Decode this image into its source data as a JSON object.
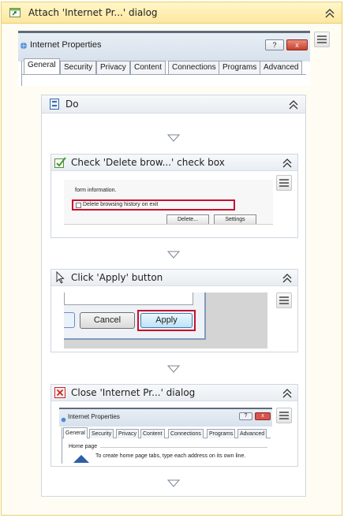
{
  "outer": {
    "title": "Attach 'Internet Pr...' dialog"
  },
  "window_preview": {
    "title": "Internet Properties",
    "help_button": "?",
    "close_button": "x",
    "tabs": [
      "General",
      "Security",
      "Privacy",
      "Content",
      "Connections",
      "Programs",
      "Advanced"
    ]
  },
  "sequence": {
    "title": "Do"
  },
  "check_activity": {
    "title": "Check 'Delete brow...' check box",
    "preview": {
      "text_line": "form information.",
      "checkbox_label": "Delete browsing history on exit",
      "delete_button": "Delete...",
      "settings_button": "Settings"
    }
  },
  "click_activity": {
    "title": "Click 'Apply' button",
    "preview": {
      "cancel_button": "Cancel",
      "apply_button": "Apply"
    }
  },
  "close_activity": {
    "title": "Close 'Internet Pr...' dialog",
    "preview": {
      "title": "Internet Properties",
      "help_button": "?",
      "close_button": "x",
      "tabs": [
        "General",
        "Security",
        "Privacy",
        "Content",
        "Connections",
        "Programs",
        "Advanced"
      ],
      "section_label": "Home page",
      "hint_text": "To create home page tabs, type each address on its own line."
    }
  },
  "colors": {
    "outer_border": "#e8cf72",
    "outer_header": "#fde7a0",
    "highlight_red": "#c8102e",
    "close_red": "#d9534f"
  },
  "icons": {
    "outer": "attach-window-icon",
    "sequence": "sequence-icon",
    "check": "check-icon",
    "click": "pointer-icon",
    "close": "close-window-icon",
    "collapse": "double-chevron-up-icon",
    "menu": "menu-icon",
    "connector": "triangle-down-icon"
  }
}
